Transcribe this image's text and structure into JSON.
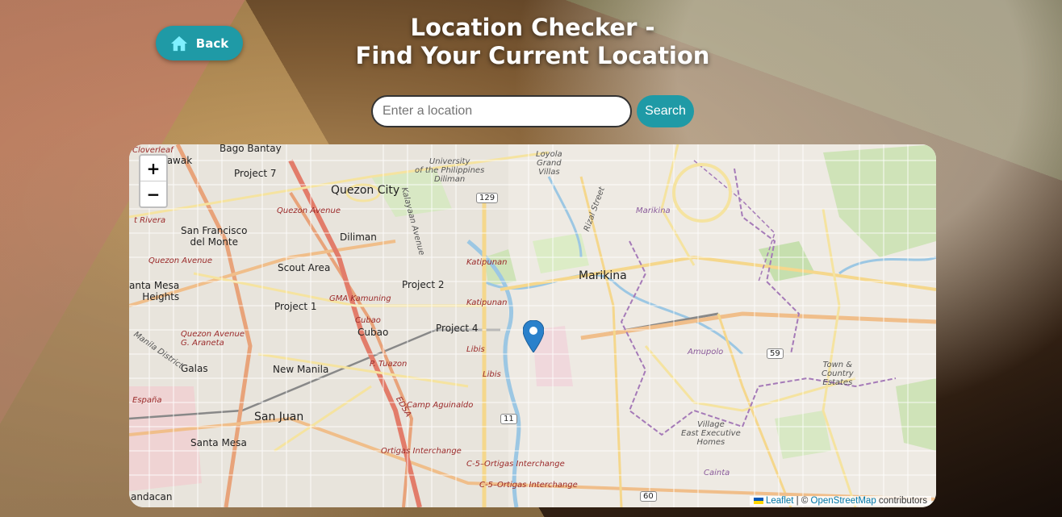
{
  "header": {
    "back_label": "Back",
    "title_line1": "Location Checker -",
    "title_line2": "Find Your Current Location"
  },
  "search": {
    "placeholder": "Enter a location",
    "value": "",
    "button_label": "Search"
  },
  "map": {
    "zoom_in": "+",
    "zoom_out": "−",
    "labels": {
      "bago_bantay": "Bago Bantay",
      "cloverleaf": "Cloverleaf",
      "tawak": "tawak",
      "project7": "Project 7",
      "quezon_city": "Quezon City",
      "up_diliman_1": "University",
      "up_diliman_2": "of the Philippines",
      "up_diliman_3": "Diliman",
      "loyola_1": "Loyola",
      "loyola_2": "Grand",
      "loyola_3": "Villas",
      "quezon_avenue_1": "Quezon Avenue",
      "san_francisco_1": "San Francisco",
      "san_francisco_2": "del Monte",
      "diliman": "Diliman",
      "scout_area": "Scout Area",
      "marikina_district": "Marikina",
      "marikina": "Marikina",
      "katipunan_1": "Katipunan",
      "katipunan_2": "Katipunan",
      "project2": "Project 2",
      "project1": "Project 1",
      "santa_mesa_heights_1": "anta Mesa",
      "santa_mesa_heights_2": "Heights",
      "gma_kamuning": "GMA Kamuning",
      "cubao_road": "Cubao",
      "cubao": "Cubao",
      "project4": "Project 4",
      "quezon_avenue_2": "Quezon Avenue",
      "araneta_1": "Quezon Avenue",
      "araneta_2": "G. Araneta",
      "libis_1": "Libis",
      "libis_2": "Libis",
      "p_tuazon": "P. Tuazon",
      "galas": "Galas",
      "new_manila": "New Manila",
      "amupolo": "Amupolo",
      "town_country_1": "Town &",
      "town_country_2": "Country",
      "town_country_3": "Estates",
      "espana": "España",
      "camp_aguinaldo": "Camp Aguinaldo",
      "san_juan": "San Juan",
      "santa_mesa": "Santa Mesa",
      "ortigas_interchange": "Ortigas Interchange",
      "c5_ortigas_1": "C-5–Ortigas Interchange",
      "c5_ortigas_2": "C-5–Ortigas Interchange",
      "village_1": "Village",
      "village_2": "East Executive",
      "village_3": "Homes",
      "cainta": "Cainta",
      "mandacan": "andacan",
      "kalayaan": "Kalayaan Avenue",
      "rizal_street": "Rizal Street",
      "edsa": "EDSA",
      "rivera": "t Rivera",
      "manila_district": "Manila District"
    },
    "shields": {
      "r129": "129",
      "r59": "59",
      "r11": "11",
      "r60": "60"
    },
    "attribution": {
      "leaflet": "Leaflet",
      "separator": " | © ",
      "osm": "OpenStreetMap",
      "contributors": " contributors"
    }
  },
  "colors": {
    "accent": "#1f9aa6",
    "marker": "#2a81cb"
  }
}
